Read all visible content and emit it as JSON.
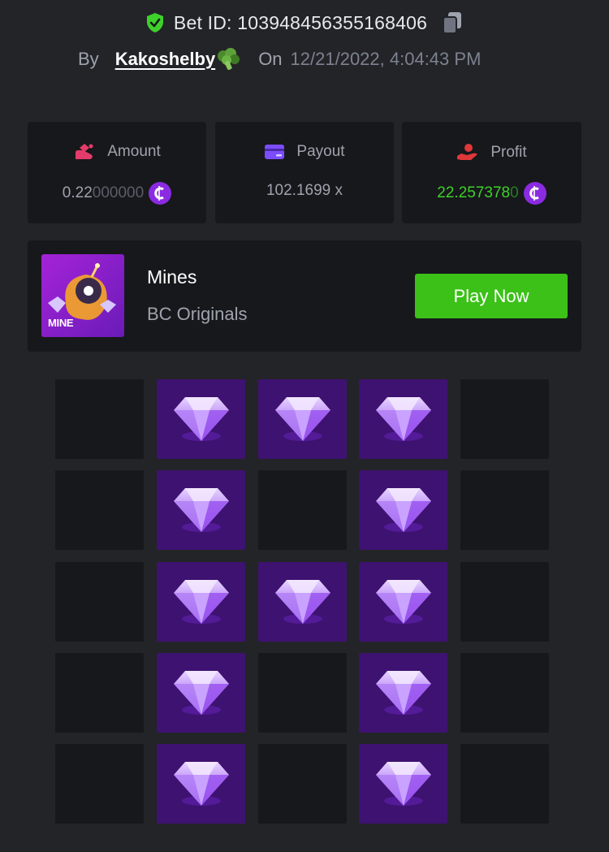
{
  "header": {
    "bet_id": "Bet ID: 103948456355168406",
    "by_label": "By",
    "username": "Kakoshelby",
    "on_label": "On",
    "date": "12/21/2022, 4:04:43 PM"
  },
  "stats": {
    "amount": {
      "label": "Amount",
      "value_main": "0.22",
      "value_dim": "000000",
      "icon": "amount-icon"
    },
    "payout": {
      "label": "Payout",
      "value": "102.1699 x",
      "icon": "card-icon"
    },
    "profit": {
      "label": "Profit",
      "value_main": "22.257378",
      "value_dim": "0",
      "icon": "profit-hand-icon"
    },
    "coin_glyph": "₵"
  },
  "game": {
    "name": "Mines",
    "provider": "BC Originals",
    "thumb_label": "MINE",
    "play_label": "Play Now"
  },
  "grid": {
    "rows": 5,
    "cols": 5,
    "cells": [
      [
        "empty",
        "gem",
        "gem",
        "gem",
        "empty"
      ],
      [
        "empty",
        "gem",
        "empty",
        "gem",
        "empty"
      ],
      [
        "empty",
        "gem",
        "gem",
        "gem",
        "empty"
      ],
      [
        "empty",
        "gem",
        "empty",
        "gem",
        "empty"
      ],
      [
        "empty",
        "gem",
        "empty",
        "gem",
        "empty"
      ]
    ]
  },
  "colors": {
    "background": "#232428",
    "card": "#17181b",
    "gem_tile": "#3e1270",
    "accent_green": "#3bc117",
    "profit_green": "#3dd12a",
    "coin_purple": "#8a2be2"
  }
}
